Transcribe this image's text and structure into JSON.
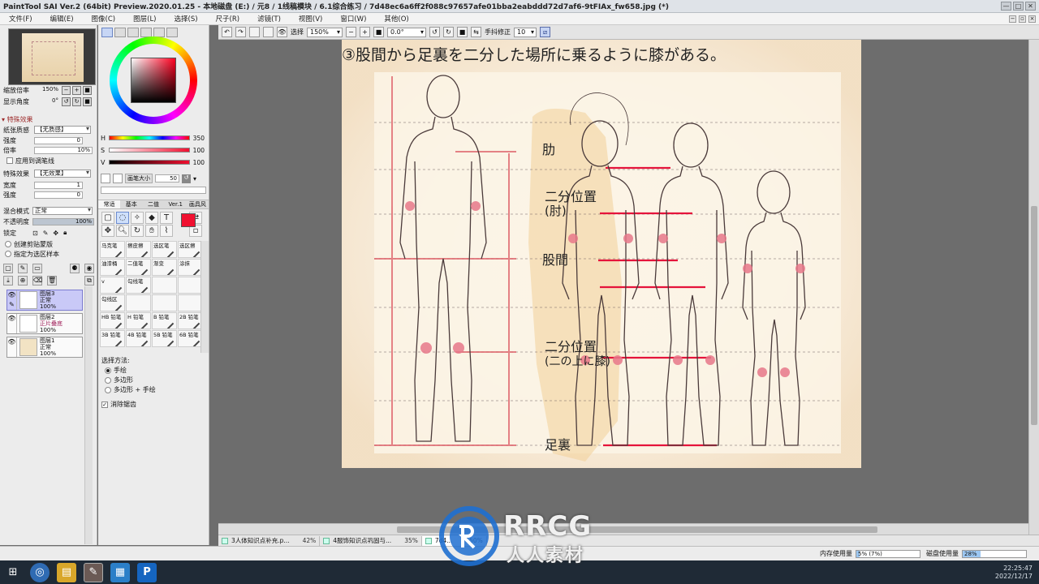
{
  "window": {
    "title": "PaintTool SAI Ver.2 (64bit) Preview.2020.01.25 - 本地磁盘 (E:) / 元8 / 1线稿模块 / 6.1综合练习 / 7d48ec6a6ff2f088c97657afe01bba2eabddd72d7af6-9tFIAx_fw658.jpg (*)",
    "controls": [
      "—",
      "□",
      "✕"
    ]
  },
  "menu": {
    "items": [
      "文件(F)",
      "编辑(E)",
      "图像(C)",
      "图层(L)",
      "选择(S)",
      "尺子(R)",
      "滤镜(T)",
      "视图(V)",
      "窗口(W)",
      "其他(O)"
    ]
  },
  "navigator": {
    "zoom_label": "缩放倍率",
    "zoom_value": "150%",
    "angle_label": "显示角度",
    "angle_value": "0°"
  },
  "special_effects": {
    "header": "特殊效果",
    "paper_label": "纸张质感",
    "paper_value": "【无质感】",
    "strength_label": "强度",
    "strength_value": "0",
    "scale_label": "倍率",
    "scale_value": "10%",
    "apply_stroke": "应用到调笔线",
    "effect_label": "特殊效果",
    "effect_value": "【无效果】",
    "width_label": "宽度",
    "width_value": "1",
    "strength2_label": "强度",
    "strength2_value": "0"
  },
  "layer_props": {
    "blend_label": "混合模式",
    "blend_value": "正常",
    "opacity_label": "不透明度",
    "opacity_value": "100%",
    "opacity_fraction": 1.0,
    "lock_label": "锁定",
    "clip": "创建剪贴蒙版",
    "ref": "指定为选区样本"
  },
  "layers": [
    {
      "name": "图层3",
      "mode": "正常",
      "opacity": "100%",
      "active": true
    },
    {
      "name": "图层2",
      "mode": "正片叠底",
      "opacity": "100%",
      "active": false
    },
    {
      "name": "图层1",
      "mode": "正常",
      "opacity": "100%",
      "active": false
    }
  ],
  "color": {
    "H_label": "H",
    "H_value": "350",
    "S_label": "S",
    "S_value": "100",
    "V_label": "V",
    "V_value": "100",
    "foreground": "#f01030"
  },
  "brush_size": {
    "label": "画笔大小",
    "value": "50"
  },
  "tool_tabs": [
    "常适",
    "基本",
    "二值",
    "Ver.1",
    "画具风"
  ],
  "brushes": [
    {
      "name": "马克笔"
    },
    {
      "name": "擦皮擦"
    },
    {
      "name": "选区笔"
    },
    {
      "name": "选区擦"
    },
    {
      "name": "油漆桶"
    },
    {
      "name": "二值笔"
    },
    {
      "name": "渐变"
    },
    {
      "name": "涂抹"
    },
    {
      "name": "v"
    },
    {
      "name": "勾线笔"
    },
    {
      "name": ""
    },
    {
      "name": ""
    },
    {
      "name": "勾线区"
    },
    {
      "name": ""
    },
    {
      "name": ""
    },
    {
      "name": ""
    },
    {
      "name": "HB 铅笔"
    },
    {
      "name": "H 铅笔"
    },
    {
      "name": "B 铅笔"
    },
    {
      "name": "2B 铅笔"
    },
    {
      "name": "3B 铅笔"
    },
    {
      "name": "4B 铅笔"
    },
    {
      "name": "5B 铅笔"
    },
    {
      "name": "6B 铅笔"
    }
  ],
  "selection_method": {
    "title": "选择方法:",
    "options": [
      "手绘",
      "多边形",
      "多边形 + 手绘"
    ],
    "antialias": "消除锯齿"
  },
  "toolbar": {
    "select_label": "选择",
    "zoom": "150%",
    "angle": "0.0°",
    "stabilizer_label": "手抖修正",
    "stabilizer_value": "10"
  },
  "canvas_text": {
    "line1": "③股間から足裏を二分した場所に乗るように膝がある。",
    "label_a": "肋",
    "label_b": "二分位置",
    "label_c": "(肘)",
    "label_d": "股間",
    "label_e": "二分位置",
    "label_f": "(二の上に膝)",
    "label_g": "足裏"
  },
  "doc_tabs": [
    {
      "name": "3人体知识点补充.p...",
      "zoom": "42%"
    },
    {
      "name": "4服饰知识点巩固与...",
      "zoom": "35%"
    },
    {
      "name": "7d4...",
      "zoom": "150%"
    }
  ],
  "status": {
    "mem_label": "内存使用量",
    "mem_value": "5% (7%)",
    "mem_fraction": 0.05,
    "disk_label": "磁盘使用量",
    "disk_value": "28%",
    "disk_fraction": 0.28
  },
  "taskbar": {
    "time": "22:25:47",
    "date": "2022/12/17"
  },
  "watermark": {
    "line1": "RRCG",
    "line2": "人人素材"
  }
}
